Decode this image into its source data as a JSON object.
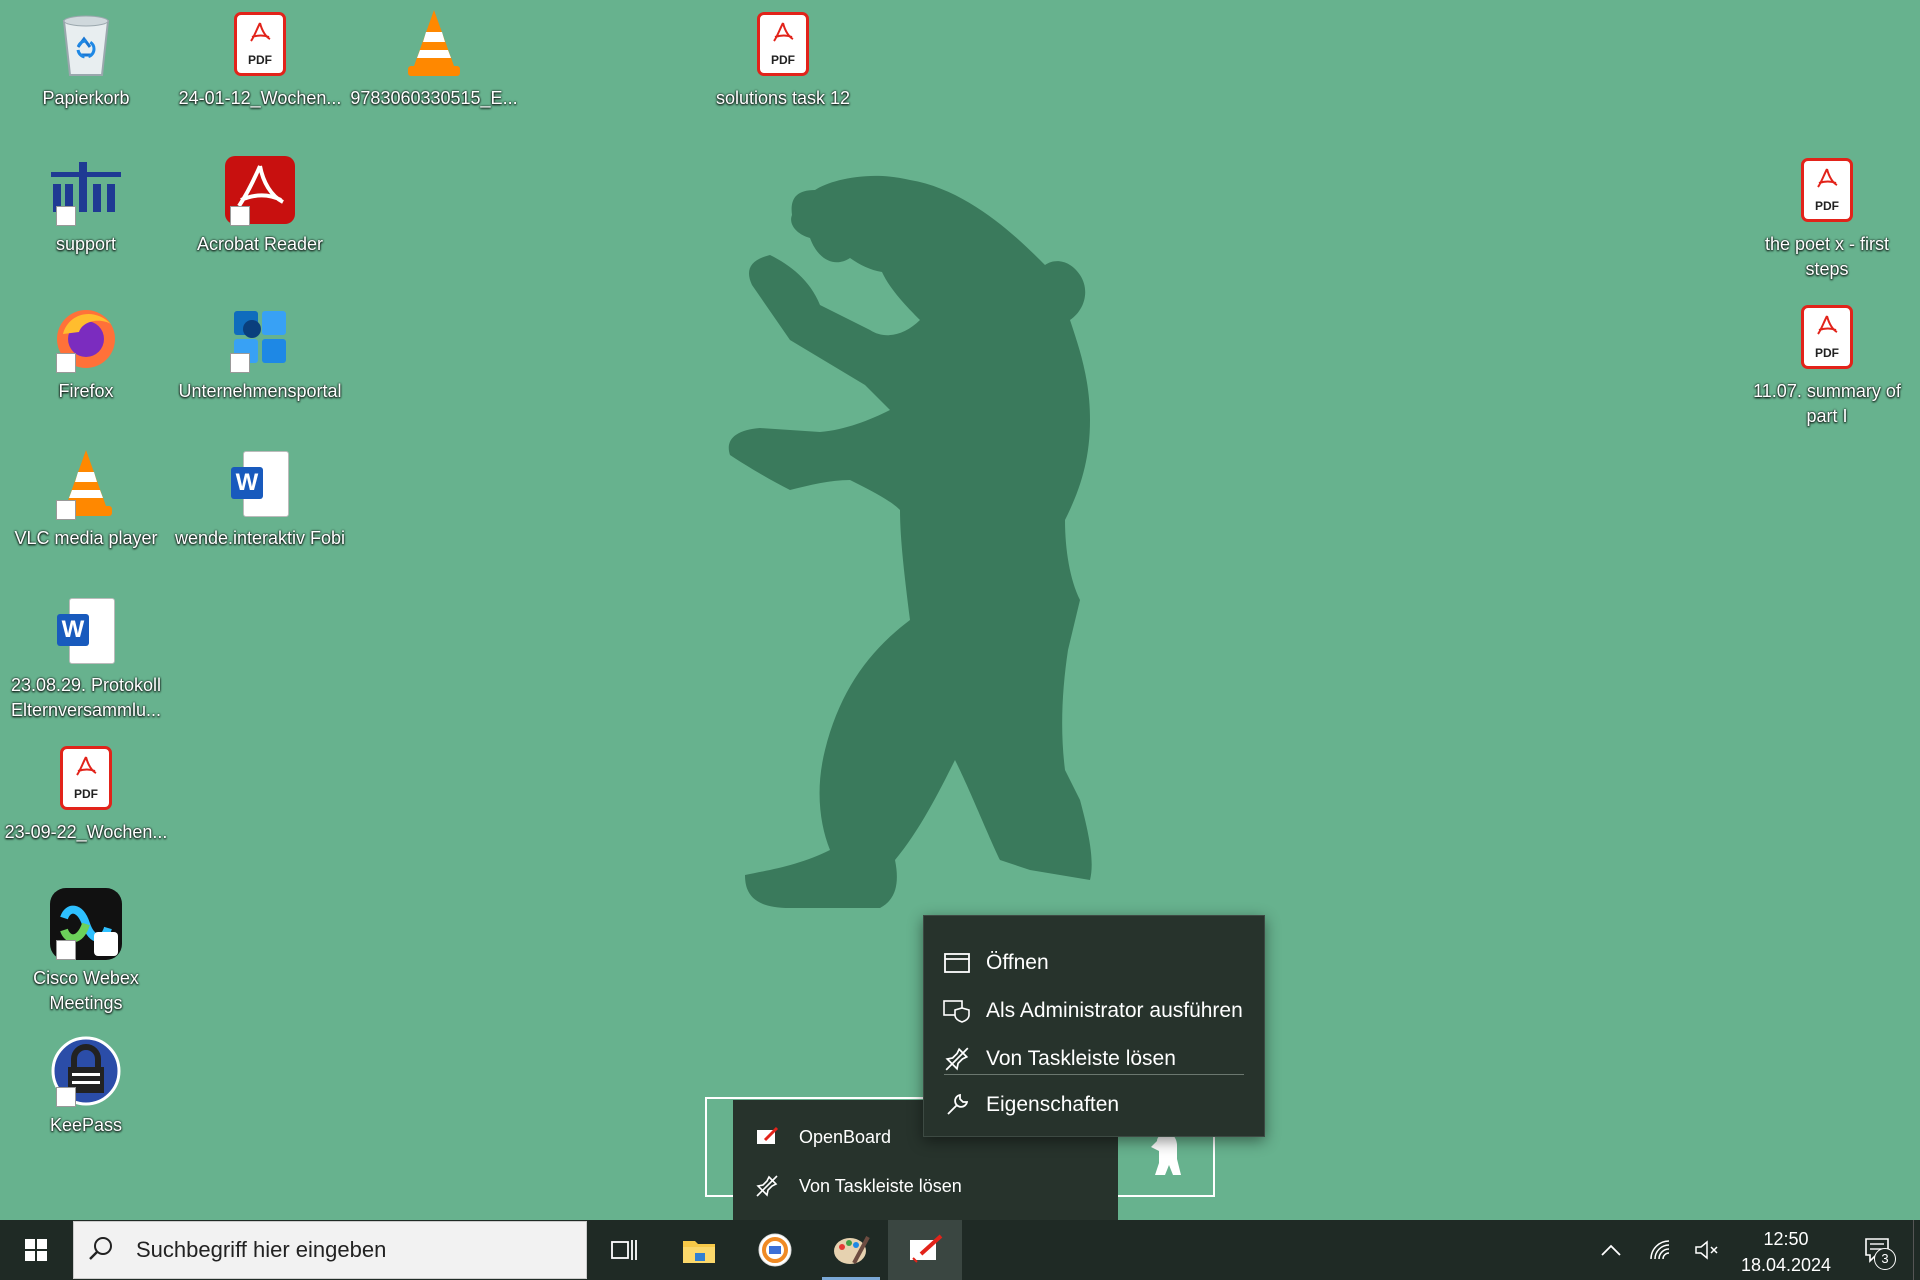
{
  "desktop_icons": [
    {
      "label": "Papierkorb",
      "icon": "recycle-bin-icon"
    },
    {
      "label": "24-01-12_Wochen...",
      "icon": "pdf-icon"
    },
    {
      "label": "9783060330515_E...",
      "icon": "vlc-icon"
    },
    {
      "label": "solutions task 12",
      "icon": "pdf-icon"
    },
    {
      "label": "support",
      "icon": "support-logo-icon"
    },
    {
      "label": "Acrobat Reader",
      "icon": "acrobat-reader-icon"
    },
    {
      "label": "the poet x - first steps",
      "icon": "pdf-icon"
    },
    {
      "label": "Firefox",
      "icon": "firefox-icon"
    },
    {
      "label": "Unternehmensportal",
      "icon": "company-portal-icon"
    },
    {
      "label": "11.07. summary of part I",
      "icon": "pdf-icon"
    },
    {
      "label": "VLC media player",
      "icon": "vlc-icon"
    },
    {
      "label": "wende.interaktiv Fobi",
      "icon": "word-document-icon"
    },
    {
      "label": "23.08.29. Protokoll Elternversammlu...",
      "icon": "word-document-icon"
    },
    {
      "label": "23-09-22_Wochen...",
      "icon": "pdf-icon"
    },
    {
      "label": "Cisco Webex Meetings",
      "icon": "webex-icon"
    },
    {
      "label": "KeePass",
      "icon": "keepass-icon"
    }
  ],
  "pdf_badge_text": "PDF",
  "word_badge_text": "W",
  "context_menu": {
    "open": "Öffnen",
    "run_as_admin": "Als Administrator ausführen",
    "unpin": "Von Taskleiste lösen",
    "properties": "Eigenschaften"
  },
  "jumplist": {
    "app_name": "OpenBoard",
    "unpin": "Von Taskleiste lösen"
  },
  "taskbar": {
    "search_placeholder": "Suchbegriff hier eingeben",
    "apps": [
      "task-view-icon",
      "file-explorer-icon",
      "browser-app-icon",
      "paint-app-icon",
      "openboard-icon"
    ],
    "time": "12:50",
    "date": "18.04.2024",
    "notification_count": "3"
  },
  "colors": {
    "desktop_background": "#67b28e",
    "bear_silhouette": "#3a7a5c",
    "menu_background": "#27332c",
    "taskbar_background": "#1f2a25"
  }
}
